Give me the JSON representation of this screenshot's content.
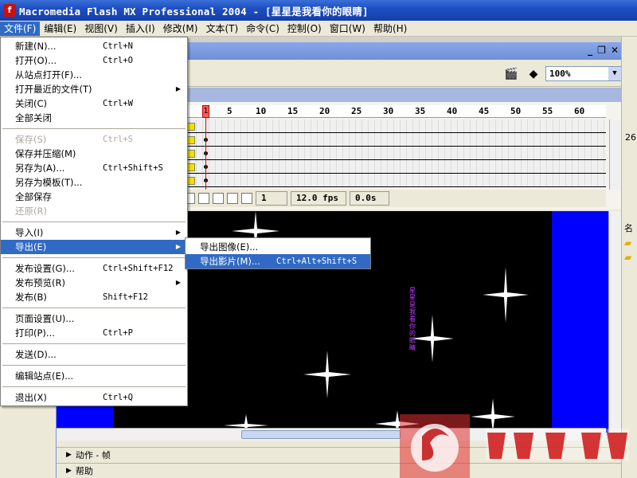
{
  "window": {
    "title": "Macromedia Flash MX Professional 2004 - [星星是我看你的眼睛]",
    "app_icon": "flash-icon"
  },
  "menubar": [
    {
      "label": "文件(F)"
    },
    {
      "label": "编辑(E)"
    },
    {
      "label": "视图(V)"
    },
    {
      "label": "插入(I)"
    },
    {
      "label": "修改(M)"
    },
    {
      "label": "文本(T)"
    },
    {
      "label": "命令(C)"
    },
    {
      "label": "控制(O)"
    },
    {
      "label": "窗口(W)"
    },
    {
      "label": "帮助(H)"
    }
  ],
  "file_menu": {
    "items": [
      {
        "label": "新建(N)...",
        "shortcut": "Ctrl+N"
      },
      {
        "label": "打开(O)...",
        "shortcut": "Ctrl+O"
      },
      {
        "label": "从站点打开(F)..."
      },
      {
        "label": "打开最近的文件(T)",
        "submenu": true
      },
      {
        "label": "关闭(C)",
        "shortcut": "Ctrl+W"
      },
      {
        "label": "全部关闭"
      },
      {
        "label": "保存(S)",
        "shortcut": "Ctrl+S",
        "disabled": true
      },
      {
        "label": "保存并压缩(M)"
      },
      {
        "label": "另存为(A)...",
        "shortcut": "Ctrl+Shift+S"
      },
      {
        "label": "另存为模板(T)..."
      },
      {
        "label": "全部保存"
      },
      {
        "label": "还原(R)",
        "disabled": true
      },
      {
        "label": "导入(I)",
        "submenu": true
      },
      {
        "label": "导出(E)",
        "submenu": true,
        "highlighted": true
      },
      {
        "label": "发布设置(G)...",
        "shortcut": "Ctrl+Shift+F12"
      },
      {
        "label": "发布预览(R)",
        "submenu": true
      },
      {
        "label": "发布(B)",
        "shortcut": "Shift+F12"
      },
      {
        "label": "页面设置(U)..."
      },
      {
        "label": "打印(P)...",
        "shortcut": "Ctrl+P"
      },
      {
        "label": "发送(D)..."
      },
      {
        "label": "编辑站点(E)..."
      },
      {
        "label": "退出(X)",
        "shortcut": "Ctrl+Q"
      }
    ]
  },
  "export_submenu": {
    "items": [
      {
        "label": "导出图像(E)..."
      },
      {
        "label": "导出影片(M)...",
        "shortcut": "Ctrl+Alt+Shift+S",
        "highlighted": true
      }
    ]
  },
  "toolbar": {
    "zoom": "100%"
  },
  "timeline": {
    "ruler": [
      "5",
      "10",
      "15",
      "20",
      "25",
      "30",
      "35",
      "40",
      "45",
      "50",
      "55",
      "60"
    ],
    "current_frame_marker": "1",
    "current_frame": "1",
    "frame_rate": "12.0 fps",
    "elapsed_time": "0.0s"
  },
  "stage": {
    "vertical_text": "星星是我看你的眼睛"
  },
  "panels": {
    "actions": "动作 - 帧",
    "help": "帮助"
  },
  "right_panel": {
    "value": "26",
    "label": "名"
  },
  "colors": {
    "menu_highlight": "#316ac5",
    "stage_bg": "#000000",
    "stage_blue": "#0000ff",
    "title_bar": "#1e4fc2"
  }
}
